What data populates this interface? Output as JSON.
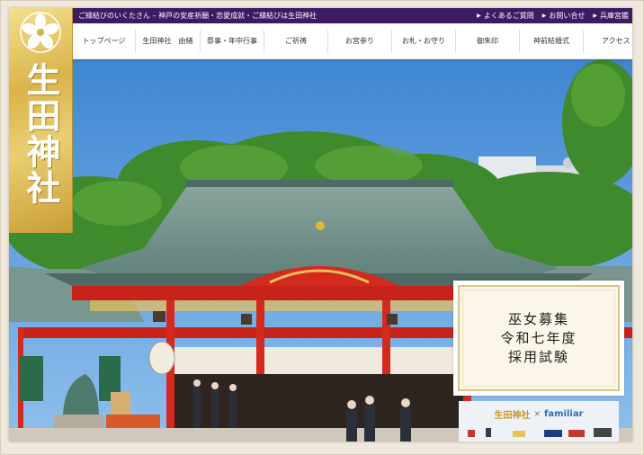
{
  "topbar": {
    "tagline": "ご縁結びのいくたさん – 神戸の安産祈願・恋愛成就・ご縁結びは生田神社",
    "links": [
      "よくあるご質問",
      "お問い合せ",
      "兵庫宮鑑"
    ]
  },
  "nav": {
    "items": [
      "トップページ",
      "生田神社　由緒",
      "祭事・年中行事",
      "ご祈祷",
      "お宮参り",
      "お札・お守り",
      "御朱印",
      "神前結婚式",
      "アクセス"
    ]
  },
  "logo": {
    "name": "生田神社",
    "crest": "sakura-crest-icon"
  },
  "recruit": {
    "lines": [
      "巫女募集",
      "令和七年度",
      "採用試験"
    ]
  },
  "familiar": {
    "shrine": "生田神社",
    "times": "×",
    "brand": "familiar"
  },
  "colors": {
    "topbar": "#3d1a63",
    "logo_gold": "#d9b44a",
    "shrine_red": "#d22a1e",
    "roof_green": "#6f8f87",
    "sky": "#4f95d8"
  }
}
